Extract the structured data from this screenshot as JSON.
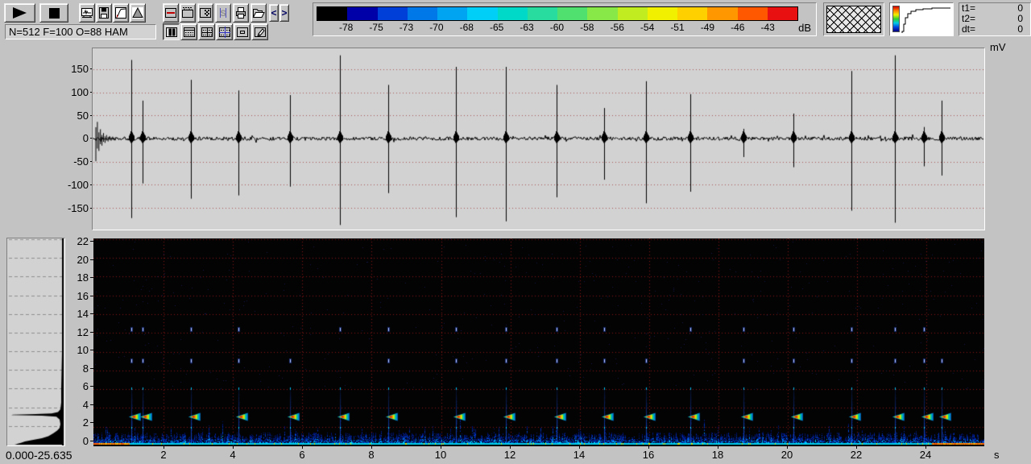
{
  "status": {
    "text": "N=512 F=100 O=88 HAM"
  },
  "toolbar": {
    "icons_row1": [
      "play-icon",
      "stop-icon",
      "scope-icon",
      "save-icon",
      "curve-icon",
      "window-function-icon",
      "display-box-icon",
      "display-ruler-icon",
      "display-checker-icon",
      "s-icon",
      "print-icon",
      "open-icon",
      "prev-icon",
      "next-icon"
    ],
    "icons_row2": [
      "layout-bars-icon",
      "layout-ruler-icon",
      "layout-grid-icon",
      "layout-crosshair-icon",
      "layout-inner-box-icon",
      "edit-icon"
    ],
    "prev_label": "<",
    "next_label": ">"
  },
  "colorbar": {
    "labels": [
      "-78",
      "-75",
      "-73",
      "-70",
      "-68",
      "-65",
      "-63",
      "-60",
      "-58",
      "-56",
      "-54",
      "-51",
      "-49",
      "-46",
      "-43"
    ],
    "unit": "dB",
    "segments": [
      "#000000",
      "#0000a8",
      "#0040d8",
      "#0078e8",
      "#00a4f0",
      "#00d0f8",
      "#00d8c8",
      "#28dca0",
      "#50e070",
      "#88e848",
      "#c0ec20",
      "#f0f000",
      "#ffd000",
      "#ff9800",
      "#ff5800",
      "#e81010"
    ]
  },
  "tpanel": {
    "rows": [
      {
        "label": "t1=",
        "value": "0"
      },
      {
        "label": "t2=",
        "value": "0"
      },
      {
        "label": "dt=",
        "value": "0"
      }
    ]
  },
  "range_label": "0.000-25.635",
  "chart_data": [
    {
      "type": "line",
      "name": "waveform",
      "ylabel_unit": "mV",
      "ylim": [
        -196,
        196
      ],
      "xlim": [
        0,
        25.7
      ],
      "grid": "dotted-red",
      "yticks": [
        "150",
        "100",
        "50",
        "0",
        "-50",
        "-100",
        "-150"
      ],
      "noise_mv": 4,
      "clicks": [
        {
          "t": 1.07,
          "up": 170,
          "down": 172
        },
        {
          "t": 1.4,
          "up": 82,
          "down": 97
        },
        {
          "t": 2.79,
          "up": 127,
          "down": 130
        },
        {
          "t": 4.16,
          "up": 104,
          "down": 123
        },
        {
          "t": 5.65,
          "up": 94,
          "down": 104
        },
        {
          "t": 7.09,
          "up": 180,
          "down": 187
        },
        {
          "t": 8.47,
          "up": 116,
          "down": 118
        },
        {
          "t": 10.42,
          "up": 155,
          "down": 170
        },
        {
          "t": 11.86,
          "up": 155,
          "down": 179
        },
        {
          "t": 13.33,
          "up": 116,
          "down": 127
        },
        {
          "t": 14.7,
          "up": 66,
          "down": 89
        },
        {
          "t": 15.91,
          "up": 124,
          "down": 140
        },
        {
          "t": 17.19,
          "up": 96,
          "down": 115
        },
        {
          "t": 18.72,
          "up": 21,
          "down": 40
        },
        {
          "t": 20.16,
          "up": 54,
          "down": 62
        },
        {
          "t": 21.84,
          "up": 146,
          "down": 156
        },
        {
          "t": 23.09,
          "up": 180,
          "down": 182
        },
        {
          "t": 23.93,
          "up": 25,
          "down": 60
        },
        {
          "t": 24.42,
          "up": 82,
          "down": 80
        }
      ]
    },
    {
      "type": "heatmap",
      "name": "spectrogram",
      "x_unit": "s",
      "xlim": [
        0,
        25.635
      ],
      "ylim": [
        0,
        22
      ],
      "grid": "dotted-red",
      "yticks": [
        "22",
        "20",
        "18",
        "16",
        "14",
        "12",
        "10",
        "8",
        "6",
        "4",
        "2",
        "0"
      ],
      "xticks": [
        "2",
        "4",
        "6",
        "8",
        "10",
        "12",
        "14",
        "16",
        "18",
        "20",
        "22",
        "24"
      ],
      "click_times": [
        1.07,
        1.4,
        2.79,
        4.16,
        5.65,
        7.09,
        8.47,
        10.42,
        11.86,
        13.33,
        14.7,
        15.91,
        17.19,
        18.72,
        20.16,
        21.84,
        23.09,
        23.93,
        24.42
      ],
      "streak_top_khz": 6.3,
      "blob_khz": 3.05,
      "dot_rows_khz": [
        9.0,
        12.3
      ],
      "noise_band_khz": 1.3
    },
    {
      "type": "area",
      "name": "average-spectrum",
      "orientation": "vertical",
      "ylim": [
        0,
        22
      ],
      "points": [
        [
          22,
          1
        ],
        [
          10,
          1
        ],
        [
          6,
          2
        ],
        [
          4.5,
          2
        ],
        [
          3.8,
          3
        ],
        [
          3.5,
          6
        ],
        [
          3.35,
          14
        ],
        [
          3.28,
          34
        ],
        [
          3.22,
          62
        ],
        [
          3.18,
          64
        ],
        [
          3.1,
          26
        ],
        [
          3.0,
          8
        ],
        [
          2.7,
          4
        ],
        [
          2.2,
          3
        ],
        [
          1.8,
          4
        ],
        [
          1.5,
          7
        ],
        [
          1.2,
          12
        ],
        [
          0.9,
          18
        ],
        [
          0.7,
          26
        ],
        [
          0.5,
          38
        ],
        [
          0.35,
          47
        ],
        [
          0.2,
          52
        ],
        [
          0.1,
          56
        ],
        [
          0.05,
          58
        ],
        [
          0,
          60
        ]
      ]
    }
  ]
}
